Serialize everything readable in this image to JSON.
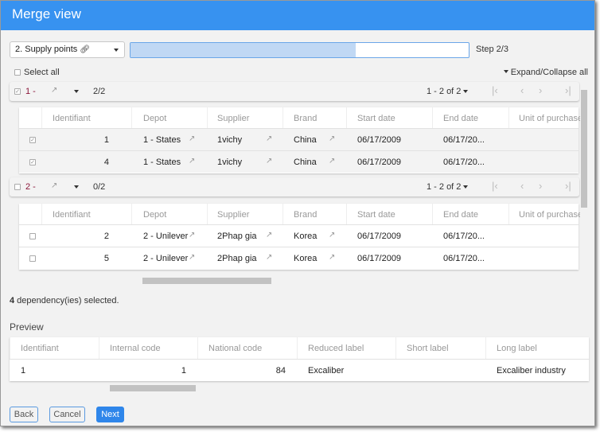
{
  "window": {
    "title": "Merge view"
  },
  "toolbar": {
    "dropdown_value": "2. Supply points",
    "dropdown_icon": "link-icon",
    "progress": 0.667,
    "progress_color": "#c0d8f4",
    "step": "Step 2/3"
  },
  "select_all": "Select all",
  "expand_collapse": "Expand/Collapse all",
  "groups": [
    {
      "label": "1 -",
      "checked": true,
      "count": "2/2",
      "pager": "1 - 2 of 2",
      "columns": [
        "Identifiant",
        "Depot",
        "Supplier",
        "Brand",
        "Start date",
        "End date",
        "Unit of purchase"
      ],
      "rows": [
        {
          "checked": true,
          "id": "1",
          "depot": "1 - States",
          "supplier": "1vichy",
          "brand": "China",
          "start": "06/17/2009",
          "end": "06/17/20..."
        },
        {
          "checked": true,
          "id": "4",
          "depot": "1 - States",
          "supplier": "1vichy",
          "brand": "China",
          "start": "06/17/2009",
          "end": "06/17/20..."
        }
      ]
    },
    {
      "label": "2 -",
      "checked": false,
      "count": "0/2",
      "pager": "1 - 2 of 2",
      "columns": [
        "Identifiant",
        "Depot",
        "Supplier",
        "Brand",
        "Start date",
        "End date",
        "Unit of purchase"
      ],
      "rows": [
        {
          "checked": false,
          "id": "2",
          "depot": "2 - Unilever",
          "supplier": "2Phap gia",
          "brand": "Korea",
          "start": "06/17/2009",
          "end": "06/17/20..."
        },
        {
          "checked": false,
          "id": "5",
          "depot": "2 - Unilever",
          "supplier": "2Phap gia",
          "brand": "Korea",
          "start": "06/17/2009",
          "end": "06/17/20..."
        }
      ]
    }
  ],
  "selection": {
    "count": "4",
    "text": " dependency(ies) selected."
  },
  "preview": {
    "title": "Preview",
    "columns": [
      "Identifiant",
      "Internal code",
      "National code",
      "Reduced label",
      "Short label",
      "Long label"
    ],
    "row": [
      "1",
      "1",
      "84",
      "Excaliber",
      "",
      "Excaliber industry"
    ]
  },
  "buttons": {
    "back": "Back",
    "cancel": "Cancel",
    "next": "Next"
  },
  "colors": {
    "accent": "#3792f0",
    "primary_button": "#2f86ea"
  }
}
